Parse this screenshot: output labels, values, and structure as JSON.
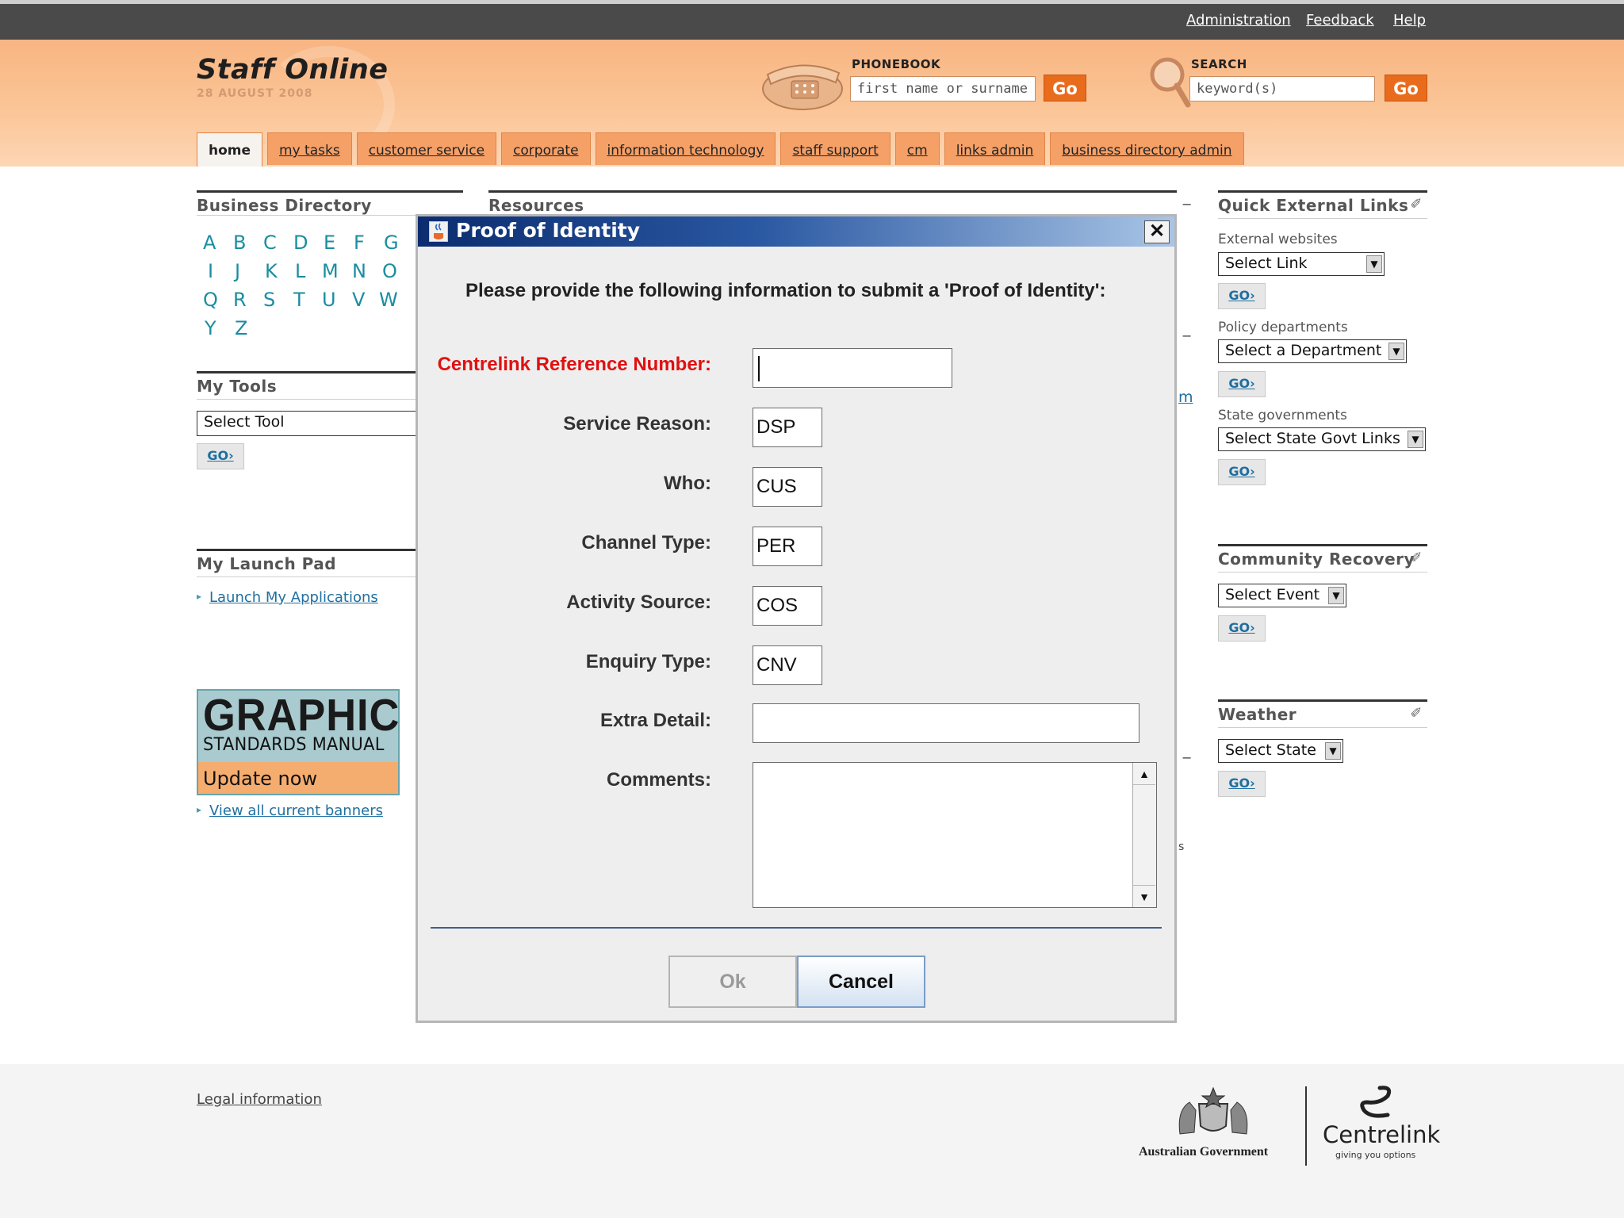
{
  "topbar": {
    "links": [
      "Administration",
      "Feedback",
      "Help"
    ]
  },
  "header": {
    "logo": "Staff Online",
    "date": "28 AUGUST 2008",
    "phonebook": {
      "label": "PHONEBOOK",
      "placeholder": "first name or surname",
      "go": "Go"
    },
    "search": {
      "label": "SEARCH",
      "placeholder": "keyword(s)",
      "go": "Go"
    }
  },
  "tabs": [
    "home",
    "my tasks",
    "customer service",
    "corporate",
    "information technology",
    "staff support",
    "cm",
    "links admin",
    "business directory admin"
  ],
  "business_directory": {
    "title": "Business Directory",
    "letters": [
      "A",
      "B",
      "C",
      "D",
      "E",
      "F",
      "G",
      "I",
      "J",
      "K",
      "L",
      "M",
      "N",
      "O",
      "Q",
      "R",
      "S",
      "T",
      "U",
      "V",
      "W",
      "Y",
      "Z"
    ]
  },
  "my_tools": {
    "title": "My Tools",
    "select": "Select Tool",
    "go": "GO›"
  },
  "launch_pad": {
    "title": "My Launch Pad",
    "link": "Launch My Applications"
  },
  "banner": {
    "line1": "GRAPHIC",
    "line2": "STANDARDS MANUAL",
    "line3": "Update now available",
    "link": "View all current banners"
  },
  "resources": {
    "title": "Resources",
    "partial_link": "m",
    "partial_text": "s"
  },
  "quick_links": {
    "title": "Quick External Links",
    "external": {
      "label": "External websites",
      "select": "Select Link"
    },
    "policy": {
      "label": "Policy departments",
      "select": "Select a Department"
    },
    "state": {
      "label": "State governments",
      "select": "Select State Govt Links"
    },
    "go": "GO›"
  },
  "community": {
    "title": "Community Recovery",
    "select": "Select Event",
    "go": "GO›"
  },
  "weather": {
    "title": "Weather",
    "select": "Select State",
    "go": "GO›"
  },
  "footer": {
    "legal": "Legal information",
    "gov": "Australian Government",
    "brand": "Centrelink",
    "tagline": "giving you options"
  },
  "dialog": {
    "title": "Proof of Identity",
    "intro": "Please provide the following information to submit a 'Proof of Identity':",
    "fields": {
      "crn": {
        "label": "Centrelink Reference Number:",
        "value": ""
      },
      "service_reason": {
        "label": "Service Reason:",
        "value": "DSP"
      },
      "who": {
        "label": "Who:",
        "value": "CUS"
      },
      "channel_type": {
        "label": "Channel Type:",
        "value": "PER"
      },
      "activity_source": {
        "label": "Activity Source:",
        "value": "COS"
      },
      "enquiry_type": {
        "label": "Enquiry Type:",
        "value": "CNV"
      },
      "extra_detail": {
        "label": "Extra Detail:",
        "value": ""
      },
      "comments": {
        "label": "Comments:",
        "value": ""
      }
    },
    "ok": "Ok",
    "cancel": "Cancel"
  }
}
